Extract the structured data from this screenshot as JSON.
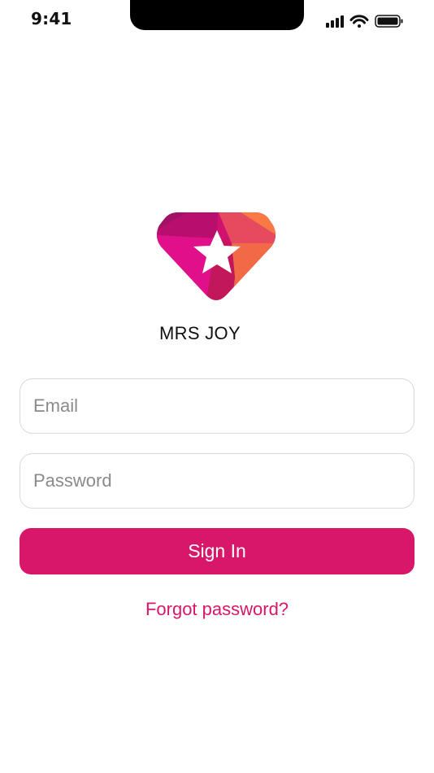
{
  "status_bar": {
    "time": "9:41",
    "icons": [
      "signal-icon",
      "wifi-icon",
      "battery-icon"
    ]
  },
  "brand": {
    "logo_icon": "diamond-star-logo",
    "app_name": "MRS JOY"
  },
  "form": {
    "email_placeholder": "Email",
    "email_value": "",
    "password_placeholder": "Password",
    "password_value": "",
    "sign_in_label": "Sign In",
    "forgot_password_label": "Forgot password?"
  },
  "colors": {
    "accent": "#d8166a",
    "field_border": "#d9d9d9",
    "placeholder": "#8a8a8a",
    "text": "#111111",
    "background": "#ffffff"
  }
}
